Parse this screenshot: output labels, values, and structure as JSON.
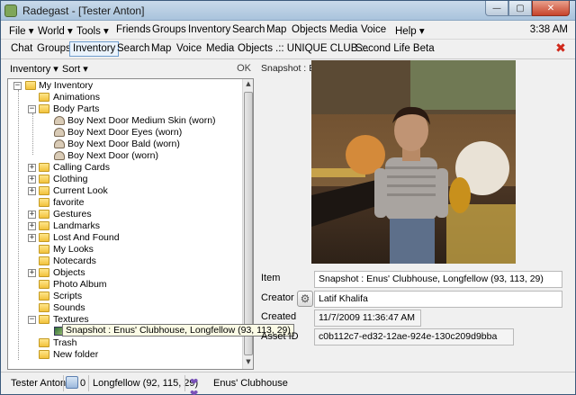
{
  "window": {
    "title": "Radegast - [Tester Anton]",
    "controls": [
      "—",
      "▢",
      "✕"
    ]
  },
  "menu": {
    "items": [
      "File",
      "World",
      "Tools",
      "Friends",
      "Groups",
      "Inventory",
      "Search",
      "Map",
      "Objects",
      "Media",
      "Voice",
      "Help"
    ],
    "clock": "3:38 AM"
  },
  "tabs": [
    "Chat",
    "Groups",
    "Inventory",
    "Search",
    "Map",
    "Voice",
    "Media",
    "Objects",
    ".:: UNIQUE CLUB ::.",
    "Second Life Beta"
  ],
  "active_tab": "Inventory",
  "inventory_toolbar": {
    "inventory_label": "Inventory",
    "sort_label": "Sort",
    "ok_label": "OK"
  },
  "tree": {
    "root": "My Inventory",
    "items": [
      "Animations",
      "Body Parts",
      "Boy Next Door Medium Skin (worn)",
      "Boy Next Door Eyes (worn)",
      "Boy Next Door Bald (worn)",
      "Boy Next Door (worn)",
      "Calling Cards",
      "Clothing",
      "Current Look",
      "favorite",
      "Gestures",
      "Landmarks",
      "Lost And Found",
      "My Looks",
      "Notecards",
      "Objects",
      "Photo Album",
      "Scripts",
      "Sounds",
      "Textures",
      "Trash",
      "New folder"
    ],
    "tooltip": "Snapshot : Enus' Clubhouse, Longfellow (93, 113, 29)"
  },
  "details": {
    "snapshot_label": "Snapshot : Enus'",
    "item_label": "Item",
    "item_value": "Snapshot : Enus' Clubhouse, Longfellow (93, 113, 29)",
    "creator_label": "Creator",
    "creator_value": "Latif Khalifa",
    "created_label": "Created",
    "created_value": "11/7/2009 11:36:47 AM",
    "asset_label": "Asset ID",
    "asset_value": "c0b112c7-ed32-12ae-924e-130c209d9bba"
  },
  "status": {
    "user": "Tester Anton",
    "balance": "0",
    "region": "Longfellow (92, 115, 29)",
    "parcel": "Enus' Clubhouse"
  },
  "colors": {
    "title_gradient": "#b9cfe4",
    "close_tab": "#d0281a",
    "tree_border": "#8a8a8a"
  }
}
